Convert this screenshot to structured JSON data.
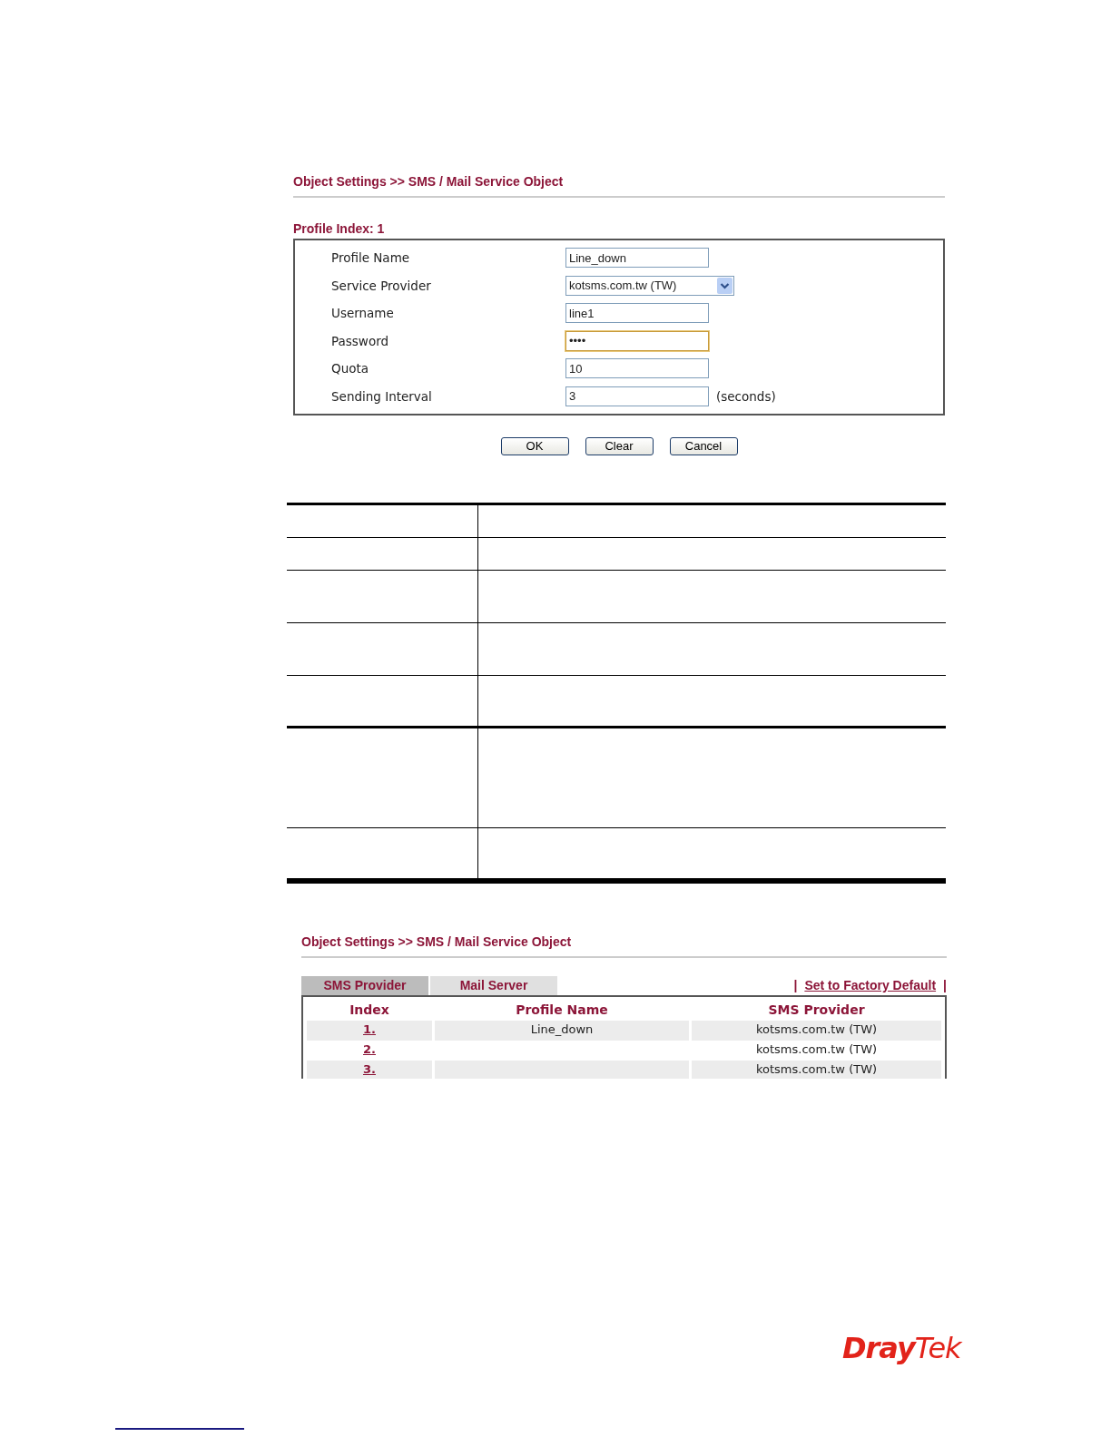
{
  "settings_screen": {
    "breadcrumb": "Object Settings >> SMS / Mail Service Object",
    "profile_index": "Profile Index: 1",
    "fields": [
      {
        "label": "Profile Name",
        "kind": "text",
        "value": "Line_down",
        "focused": false
      },
      {
        "label": "Service Provider",
        "kind": "select",
        "value": "kotsms.com.tw (TW)",
        "focused": false
      },
      {
        "label": "Username",
        "kind": "text",
        "value": "line1",
        "focused": false
      },
      {
        "label": "Password",
        "kind": "password",
        "value": "••••",
        "focused": true
      },
      {
        "label": "Quota",
        "kind": "text",
        "value": "10",
        "focused": false
      },
      {
        "label": "Sending Interval",
        "kind": "text",
        "value": "3",
        "focused": false,
        "unit": "(seconds)"
      }
    ],
    "buttons": [
      "OK",
      "Clear",
      "Cancel"
    ]
  },
  "description_table": {
    "rows": [
      {
        "kind": "single",
        "thick_rule_below": false
      },
      {
        "kind": "single",
        "thick_rule_below": false
      },
      {
        "kind": "double",
        "thick_rule_below": false
      },
      {
        "kind": "double",
        "thick_rule_below": false
      },
      {
        "kind": "double",
        "thick_rule_below": true
      },
      {
        "kind": "quad",
        "thick_rule_below": false
      },
      {
        "kind": "double",
        "thick_rule_below": true
      }
    ]
  },
  "list_screen": {
    "breadcrumb": "Object Settings >> SMS / Mail Service Object",
    "tabs": [
      {
        "label": "SMS Provider",
        "selected": true
      },
      {
        "label": "Mail Server",
        "selected": false
      }
    ],
    "separator_left": "|",
    "factory_default_link": "Set to Factory Default",
    "separator_right": "|",
    "columns": [
      "Index",
      "Profile Name",
      "SMS Provider"
    ],
    "rows": [
      {
        "index": "1.",
        "profile_name": "Line_down",
        "provider": "kotsms.com.tw (TW)"
      },
      {
        "index": "2.",
        "profile_name": "",
        "provider": "kotsms.com.tw (TW)"
      },
      {
        "index": "3.",
        "profile_name": "",
        "provider": "kotsms.com.tw (TW)"
      }
    ]
  },
  "logo": {
    "brand_left": "Dray",
    "brand_right": "Tek"
  }
}
